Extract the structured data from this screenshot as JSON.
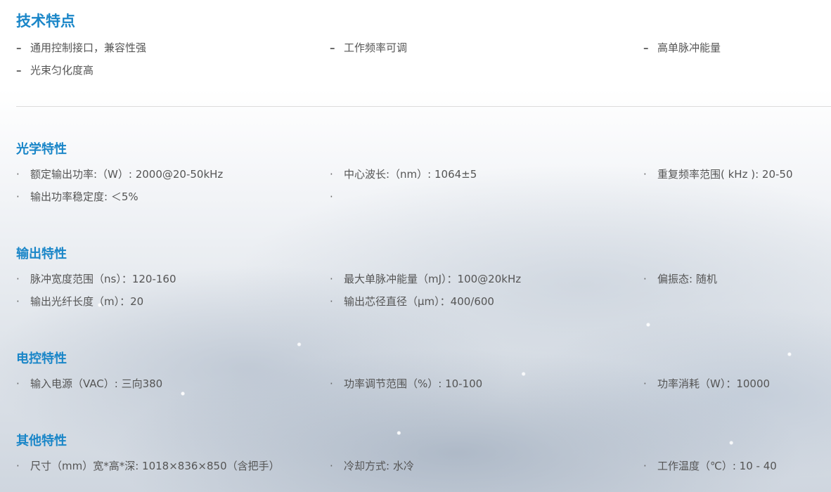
{
  "features": {
    "title": "技术特点",
    "marker": "–",
    "items": [
      "通用控制接口，兼容性强",
      "工作频率可调",
      "高单脉冲能量",
      "光束匀化度高"
    ]
  },
  "optical": {
    "title": "光学特性",
    "marker": "·",
    "items": [
      "额定输出功率:（W）: 2000@20-50kHz",
      "中心波长:（nm）: 1064±5",
      "重复频率范围( kHz ): 20-50",
      "输出功率稳定度: ＜5%",
      ""
    ]
  },
  "output": {
    "title": "输出特性",
    "marker": "·",
    "items": [
      "脉冲宽度范围（ns）：120-160",
      "最大单脉冲能量（mJ）：100@20kHz",
      "偏振态: 随机",
      "输出光纤长度（m）：20",
      "输出芯径直径（μm）：400/600"
    ]
  },
  "electrical": {
    "title": "电控特性",
    "marker": "·",
    "items": [
      "输入电源（VAC）: 三向380",
      "功率调节范围（%）: 10-100",
      "功率消耗（W）：10000"
    ]
  },
  "other": {
    "title": "其他特性",
    "marker": "·",
    "items": [
      "尺寸（mm）宽*高*深: 1018×836×850（含把手）",
      "冷却方式: 水冷",
      "工作温度（℃）: 10 - 40"
    ]
  },
  "colors": {
    "heading": "#1a86c8",
    "text": "#555555",
    "divider": "#dcdcdc"
  }
}
